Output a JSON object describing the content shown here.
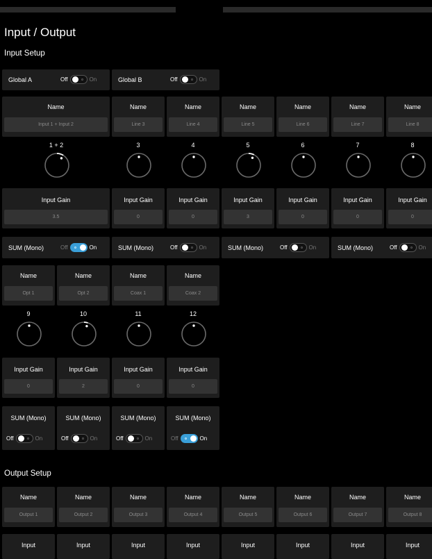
{
  "page_title": "Input / Output",
  "input_setup": {
    "title": "Input Setup",
    "name_label": "Name",
    "gain_label": "Input Gain",
    "sum_label": "SUM (Mono)",
    "toggle_off": "Off",
    "toggle_on": "On",
    "globals": [
      {
        "label": "Global A",
        "on": false
      },
      {
        "label": "Global B",
        "on": false
      }
    ],
    "channels": [
      {
        "number": "1 + 2",
        "name": "Input 1 + Input 2",
        "gain": "3.5",
        "knob": 0.62,
        "sum_on": true
      },
      {
        "number": "3",
        "name": "Line 3",
        "gain": "0",
        "knob": 0.5
      },
      {
        "number": "4",
        "name": "Line 4",
        "gain": "0",
        "knob": 0.5,
        "sum_on": false
      },
      {
        "number": "5",
        "name": "Line 5",
        "gain": "3",
        "knob": 0.6
      },
      {
        "number": "6",
        "name": "Line 6",
        "gain": "0",
        "knob": 0.5,
        "sum_on": false
      },
      {
        "number": "7",
        "name": "Line 7",
        "gain": "0",
        "knob": 0.5
      },
      {
        "number": "8",
        "name": "Line 8",
        "gain": "0",
        "knob": 0.5,
        "sum_on": false
      },
      {
        "number": "9",
        "name": "Opt 1",
        "gain": "0",
        "knob": 0.5,
        "sum_on": false
      },
      {
        "number": "10",
        "name": "Opt 2",
        "gain": "2",
        "knob": 0.57,
        "sum_on": false
      },
      {
        "number": "11",
        "name": "Coax 1",
        "gain": "0",
        "knob": 0.5,
        "sum_on": false
      },
      {
        "number": "12",
        "name": "Coax 2",
        "gain": "0",
        "knob": 0.5,
        "sum_on": true
      }
    ]
  },
  "output_setup": {
    "title": "Output Setup",
    "name_label": "Name",
    "input_label": "Input",
    "outputs": [
      "Output 1",
      "Output 2",
      "Output 3",
      "Output 4",
      "Output 5",
      "Output 6",
      "Output 7",
      "Output 8"
    ]
  },
  "colors": {
    "accent": "#3a9fd8",
    "background": "#000000",
    "card": "#1e1e1e",
    "field": "#333333"
  }
}
